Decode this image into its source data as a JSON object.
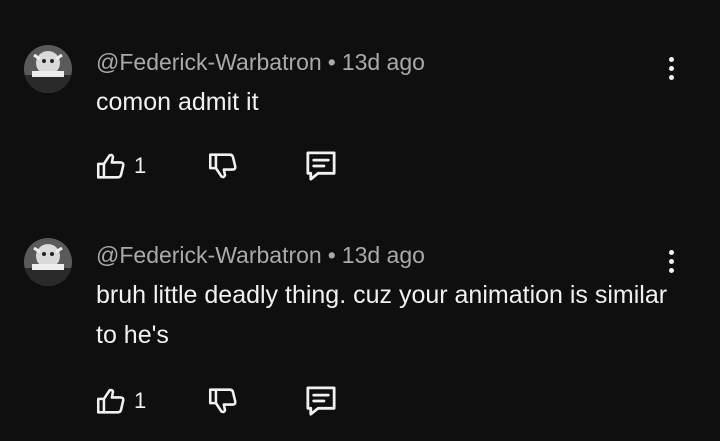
{
  "comments": [
    {
      "author": "@Federick-Warbatron",
      "separator": "•",
      "time": "13d ago",
      "text": "comon admit it",
      "likes": "1"
    },
    {
      "author": "@Federick-Warbatron",
      "separator": "•",
      "time": "13d ago",
      "text": "bruh little deadly thing. cuz your animation is similar to he's",
      "likes": "1"
    }
  ],
  "icons": {
    "like": "thumbs-up-icon",
    "dislike": "thumbs-down-icon",
    "reply": "reply-icon",
    "more": "more-vertical-icon"
  },
  "colors": {
    "background": "#0f0f0f",
    "text": "#f1f1f1",
    "meta": "#aaaaaa"
  }
}
